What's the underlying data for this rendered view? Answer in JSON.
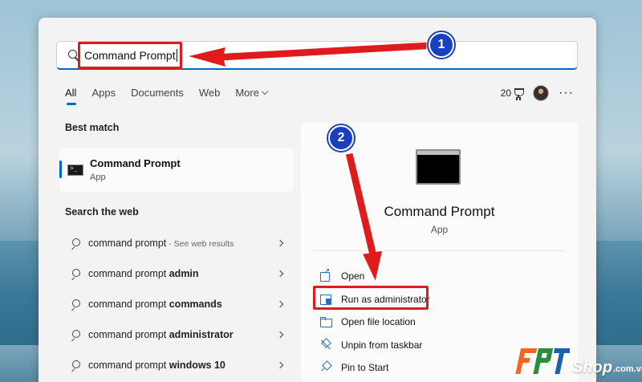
{
  "search": {
    "query": "Command Prompt"
  },
  "tabs": [
    {
      "label": "All"
    },
    {
      "label": "Apps"
    },
    {
      "label": "Documents"
    },
    {
      "label": "Web"
    },
    {
      "label": "More"
    }
  ],
  "header_right": {
    "points": "20"
  },
  "left": {
    "best_match_title": "Best match",
    "best_match": {
      "name": "Command Prompt",
      "type": "App"
    },
    "search_web_title": "Search the web",
    "web_results": [
      {
        "prefix": "command prompt",
        "bold": "",
        "hint": " - See web results"
      },
      {
        "prefix": "command prompt ",
        "bold": "admin",
        "hint": ""
      },
      {
        "prefix": "command prompt ",
        "bold": "commands",
        "hint": ""
      },
      {
        "prefix": "command prompt ",
        "bold": "administrator",
        "hint": ""
      },
      {
        "prefix": "command prompt ",
        "bold": "windows 10",
        "hint": ""
      }
    ]
  },
  "right": {
    "app_name": "Command Prompt",
    "app_type": "App",
    "actions": [
      {
        "label": "Open",
        "icon": "open-icon"
      },
      {
        "label": "Run as administrator",
        "icon": "shield-admin-icon"
      },
      {
        "label": "Open file location",
        "icon": "folder-icon"
      },
      {
        "label": "Unpin from taskbar",
        "icon": "unpin-icon"
      },
      {
        "label": "Pin to Start",
        "icon": "pin-icon"
      }
    ]
  },
  "annotations": {
    "step1": "1",
    "step2": "2",
    "color": "#e01b1b"
  },
  "watermark": {
    "brand": "FPT",
    "text": "Shop",
    "suffix": ".com.vn"
  },
  "colors": {
    "accent": "#0067c0",
    "badge": "#1a3fbf",
    "highlight": "#e01b1b"
  }
}
